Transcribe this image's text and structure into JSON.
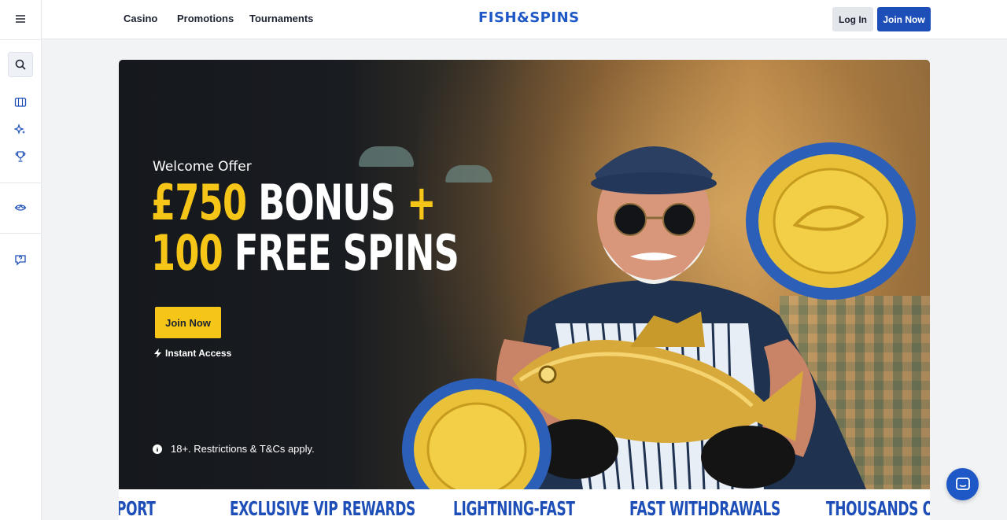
{
  "header": {
    "nav": [
      "Casino",
      "Promotions",
      "Tournaments"
    ],
    "logo": "FISH&SPINS",
    "login_label": "Log In",
    "join_label": "Join Now"
  },
  "sidebar": {
    "icons": [
      "menu-icon",
      "search-icon",
      "slots-icon",
      "sparkle-icon",
      "trophy-icon",
      "loyalty-icon",
      "help-icon"
    ]
  },
  "hero": {
    "eyebrow": "Welcome Offer",
    "line1_highlight": "£750",
    "line1_rest": "BONUS",
    "line1_plus": "+",
    "line2_highlight": "100",
    "line2_rest": "FREE SPINS",
    "cta_label": "Join Now",
    "instant_access": "Instant Access",
    "terms": "18+. Restrictions & T&Cs apply."
  },
  "features": [
    "PORT",
    "EXCLUSIVE VIP REWARDS",
    "LIGHTNING-FAST",
    "FAST WITHDRAWALS",
    "THOUSANDS OF GA"
  ],
  "colors": {
    "brand_blue": "#1e4fb8",
    "accent_yellow": "#f5c518",
    "hero_dark": "#15181d"
  }
}
